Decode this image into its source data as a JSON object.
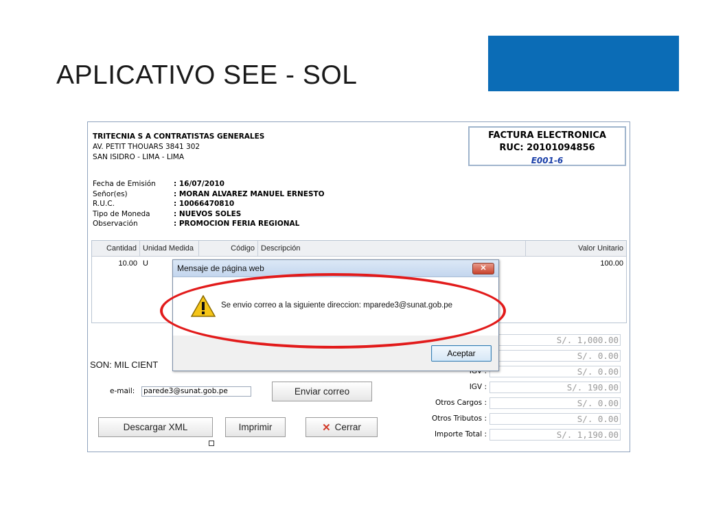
{
  "slide": {
    "title": "APLICATIVO SEE - SOL"
  },
  "colors": {
    "accent": "#0b6cb6",
    "annotation": "#e21b1b"
  },
  "company": {
    "name": "TRITECNIA S A CONTRATISTAS GENERALES",
    "address1": "AV. PETIT THOUARS 3841 302",
    "address2": "SAN ISIDRO - LIMA - LIMA"
  },
  "invoice": {
    "type": "FACTURA ELECTRONICA",
    "ruc": "RUC: 20101094856",
    "serie": "E001-6"
  },
  "meta": [
    {
      "label": "Fecha de Emisión",
      "value": ": 16/07/2010"
    },
    {
      "label": "Señor(es)",
      "value": ": MORAN ALVAREZ MANUEL ERNESTO"
    },
    {
      "label": "R.U.C.",
      "value": ": 10066470810"
    },
    {
      "label": "Tipo de Moneda",
      "value": ": NUEVOS SOLES"
    },
    {
      "label": "Observación",
      "value": ": PROMOCION FERIA REGIONAL"
    }
  ],
  "table": {
    "headers": [
      "Cantidad",
      "Unidad Medida",
      "Código",
      "Descripción",
      "Valor Unitario"
    ],
    "rows": [
      {
        "cantidad": "10.00",
        "unidad": "U",
        "codigo": "",
        "descripcion": "",
        "valor": "100.00"
      }
    ]
  },
  "son": "SON: MIL CIENT",
  "email": {
    "label": "e-mail:",
    "value": "parede3@sunat.gob.pe"
  },
  "buttons": {
    "enviar": "Enviar correo",
    "xml": "Descargar XML",
    "imprimir": "Imprimir",
    "cerrar": "Cerrar"
  },
  "totals": [
    {
      "label": "",
      "value": "S/. 1,000.00"
    },
    {
      "label": "",
      "value": "S/. 0.00"
    },
    {
      "label": "IGV :",
      "value": "S/. 0.00"
    },
    {
      "label": "IGV :",
      "value": "S/. 190.00"
    },
    {
      "label": "Otros Cargos :",
      "value": "S/. 0.00"
    },
    {
      "label": "Otros Tributos :",
      "value": "S/. 0.00"
    },
    {
      "label": "Importe Total :",
      "value": "S/. 1,190.00"
    }
  ],
  "dialog": {
    "title": "Mensaje de página web",
    "close_glyph": "✕",
    "message": "Se envio correo a la siguiente direccion: mparede3@sunat.gob.pe",
    "ok_label": "Aceptar",
    "icon": "warning-icon"
  }
}
